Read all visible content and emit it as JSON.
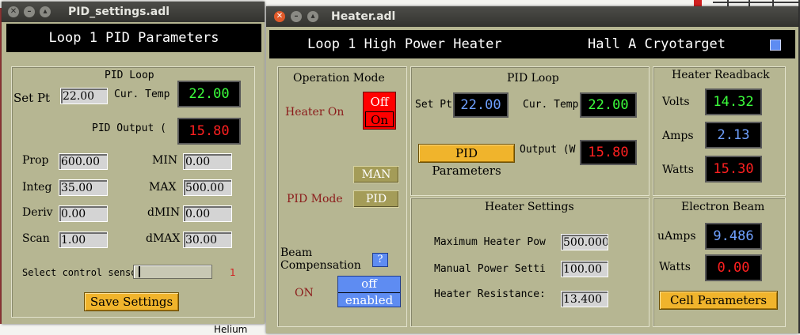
{
  "pid_settings": {
    "window_title": "PID_settings.adl",
    "banner": "Loop 1 PID Parameters",
    "group_label": "PID Loop",
    "set_pt_label": "Set Pt",
    "set_pt_value": "22.00",
    "cur_temp_label": "Cur. Temp",
    "cur_temp_value": "22.00",
    "output_label": "PID Output (",
    "output_value": "15.80",
    "prop_label": "Prop",
    "prop_value": "600.00",
    "integ_label": "Integ",
    "integ_value": "35.00",
    "deriv_label": "Deriv",
    "deriv_value": "0.00",
    "scan_label": "Scan",
    "scan_value": "1.00",
    "min_label": "MIN",
    "min_value": "0.00",
    "max_label": "MAX",
    "max_value": "500.00",
    "dmin_label": "dMIN",
    "dmin_value": "0.00",
    "dmax_label": "dMAX",
    "dmax_value": "30.00",
    "sensor_label": "Select control senso",
    "sensor_value": "1",
    "save_button": "Save Settings"
  },
  "heater": {
    "window_title": "Heater.adl",
    "banner_left": "Loop 1 High Power Heater",
    "banner_right": "Hall A Cryotarget",
    "operation": {
      "title": "Operation Mode",
      "heater_label": "Heater On",
      "off_button": "Off",
      "on_button": "On",
      "man_button": "MAN",
      "pid_mode_label": "PID Mode",
      "pid_button": "PID",
      "beam_label_1": "Beam",
      "beam_label_2": "Compensation",
      "help_button": "?",
      "on_status": "ON",
      "off_choice": "off",
      "enabled_choice": "enabled"
    },
    "pid_loop": {
      "title": "PID Loop",
      "set_pt_label": "Set Pt",
      "set_pt_value": "22.00",
      "cur_temp_label": "Cur. Temp",
      "cur_temp_value": "22.00",
      "pid_params_button": "PID Parameters",
      "output_label": "Output (W",
      "output_value": "15.80"
    },
    "readback": {
      "title": "Heater Readback",
      "volts_label": "Volts",
      "volts_value": "14.32",
      "amps_label": "Amps",
      "amps_value": "2.13",
      "watts_label": "Watts",
      "watts_value": "15.30"
    },
    "settings": {
      "title": "Heater Settings",
      "max_power_label": "Maximum Heater Pow",
      "max_power_value": "500.000",
      "manual_power_label": "Manual Power Setti",
      "manual_power_value": "100.00",
      "resistance_label": "Heater Resistance:",
      "resistance_value": "13.400"
    },
    "beam": {
      "title": "Electron Beam",
      "uamps_label": "uAmps",
      "uamps_value": "9.486",
      "watts_label": "Watts",
      "watts_value": "0.00",
      "cell_params_button": "Cell Parameters"
    }
  },
  "background": {
    "fragment_label": "Helium"
  },
  "colors": {
    "panel_bg": "#b6b692",
    "display_green": "#3cff3c",
    "display_red": "#ff2020",
    "display_blue": "#6fa0ff",
    "button_yellow": "#f0b42c",
    "alarm_red": "#ff0000",
    "choice_blue": "#5e8cf2"
  }
}
